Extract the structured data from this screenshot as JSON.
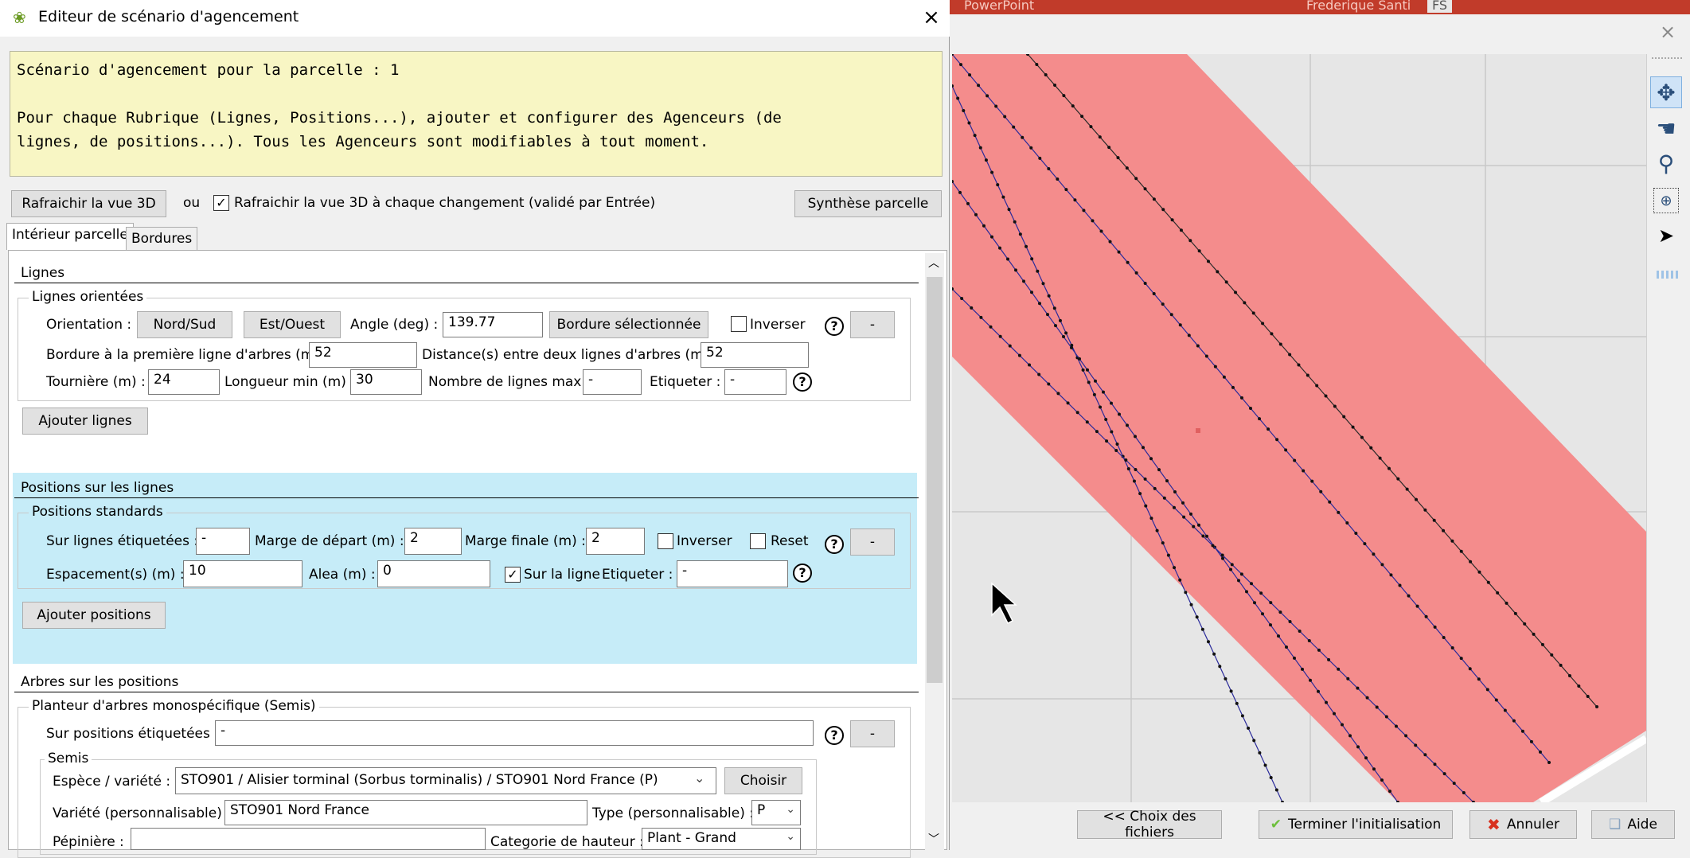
{
  "dialog": {
    "title": "Editeur de scénario d'agencement",
    "close": "×",
    "info": {
      "line1": "Scénario d'agencement pour la parcelle : 1",
      "line2": "Pour chaque Rubrique (Lignes, Positions...), ajouter et configurer des Agenceurs (de",
      "line3": "lignes, de positions...). Tous les Agenceurs sont modifiables à tout moment."
    },
    "refresh_button": "Rafraichir la vue 3D",
    "or_label": "ou",
    "auto_refresh_label": "Rafraichir la vue 3D à chaque changement (validé par Entrée)",
    "auto_refresh_checked": true,
    "summary_button": "Synthèse parcelle",
    "tabs": [
      "Intérieur parcelle",
      "Bordures"
    ],
    "lignes": {
      "title": "Lignes",
      "group": "Lignes orientées",
      "orientation_label": "Orientation :",
      "north_south": "Nord/Sud",
      "east_west": "Est/Ouest",
      "angle_label": "Angle (deg) :",
      "angle_value": "139.77",
      "selected_border": "Bordure sélectionnée",
      "invert_label": "Inverser",
      "help": "?",
      "minus": "-",
      "first_row_label": "Bordure à la première ligne d'arbres (m) :",
      "first_row_value": "52",
      "distance_label": "Distance(s) entre deux lignes d'arbres (m) :",
      "distance_value": "52",
      "turning_label": "Tournière (m) :",
      "turning_value": "24",
      "min_length_label": "Longueur min (m) :",
      "min_length_value": "30",
      "max_rows_label": "Nombre de lignes max :",
      "max_rows_value": "-",
      "label_label": "Etiqueter :",
      "label_value": "-",
      "add_button": "Ajouter lignes"
    },
    "positions": {
      "title": "Positions sur les lignes",
      "group": "Positions standards",
      "tagged_label": "Sur lignes étiquetées :",
      "tagged_value": "-",
      "start_margin_label": "Marge de départ (m) :",
      "start_margin_value": "2",
      "end_margin_label": "Marge finale (m) :",
      "end_margin_value": "2",
      "invert_label": "Inverser",
      "reset_label": "Reset",
      "help": "?",
      "minus": "-",
      "spacing_label": "Espacement(s) (m) :",
      "spacing_value": "10",
      "random_label": "Alea (m) :",
      "random_value": "0",
      "on_line_label": "Sur la ligne",
      "on_line_checked": true,
      "label_label": "Etiqueter :",
      "label_value": "-",
      "add_button": "Ajouter positions"
    },
    "trees": {
      "title": "Arbres sur les positions",
      "group": "Planteur d'arbres monospécifique (Semis)",
      "tagged_label": "Sur positions étiquetées :",
      "tagged_value": "-",
      "help": "?",
      "minus": "-",
      "subgroup": "Semis",
      "species_label": "Espèce / variété :",
      "species_value": "STO901 / Alisier torminal (Sorbus torminalis) / STO901 Nord France (P)",
      "choose_button": "Choisir",
      "variety_label": "Variété (personnalisable) :",
      "variety_value": "STO901 Nord France",
      "type_label": "Type (personnalisable) :",
      "type_value": "P",
      "nursery_label": "Pépinière :",
      "nursery_value": "",
      "height_label": "Categorie de hauteur :",
      "height_value": "Plant - Grand"
    }
  },
  "background_app": {
    "name": "PowerPoint",
    "user": "Frederique Santi",
    "initials": "FS"
  },
  "viewer": {
    "close": "×",
    "tools": [
      "rotate-icon",
      "pan-hand-icon",
      "zoom-icon",
      "zoom-box-icon",
      "select-arrow-icon"
    ],
    "buttons": {
      "back": "<< Choix des fichiers",
      "finish": "Terminer l'initialisation",
      "cancel": "Annuler",
      "help": "Aide"
    }
  },
  "colors": {
    "parcel_fill": "#f48c8c",
    "note_bg": "#f8f6c4",
    "positions_bg": "#c6ecf8",
    "tree_line_blue": "#2a2a9a",
    "tree_line_dark": "#2a2a2a"
  }
}
